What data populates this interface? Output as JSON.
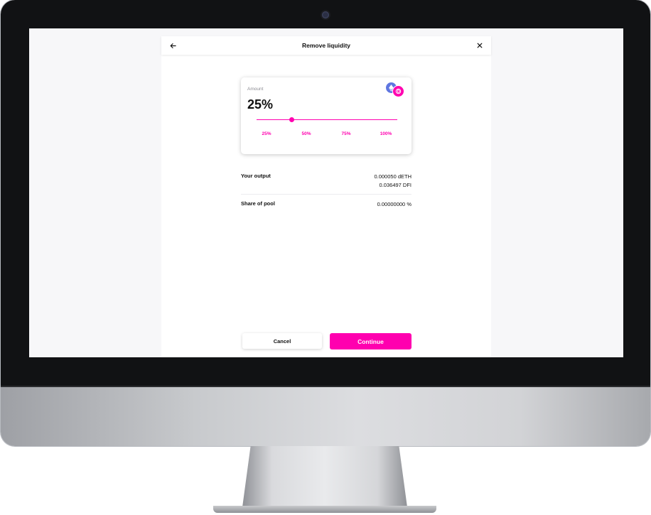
{
  "header": {
    "title": "Remove liquidity",
    "back_icon": "arrow-left-icon",
    "close_icon": "close-icon"
  },
  "amount_card": {
    "label": "Amount",
    "value": "25%",
    "slider_fraction": 0.25,
    "token_icons": [
      "eth-token-icon",
      "dfi-token-icon"
    ],
    "presets": [
      "25%",
      "50%",
      "75%",
      "100%"
    ]
  },
  "summary": {
    "output_label": "Your output",
    "output_values": [
      "0.000050 dETH",
      "0.036497 DFI"
    ],
    "share_label": "Share of pool",
    "share_value": "0.00000000 %"
  },
  "buttons": {
    "cancel": "Cancel",
    "continue": "Continue"
  },
  "colors": {
    "accent": "#ff00af",
    "eth": "#5f76e0",
    "text": "#111111",
    "muted": "#8b8b92"
  }
}
